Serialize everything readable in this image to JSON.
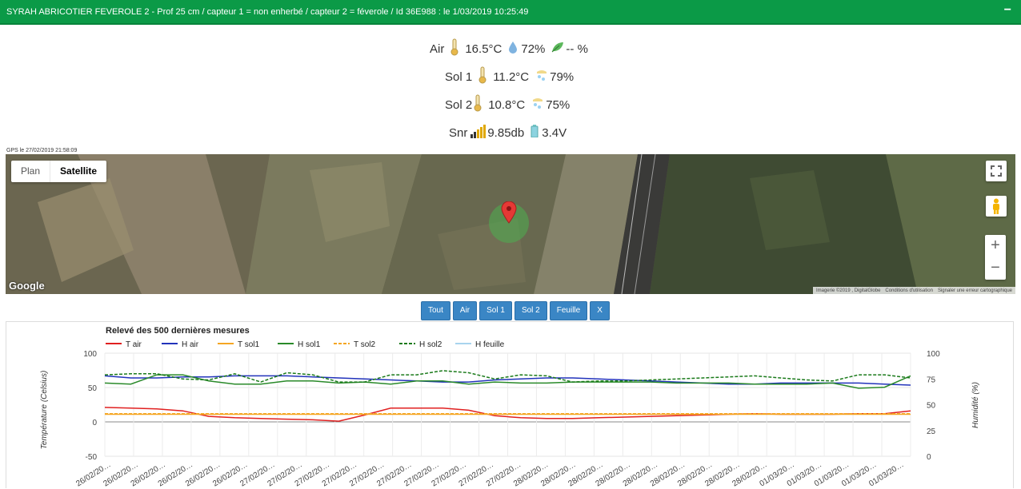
{
  "header": {
    "title": "SYRAH ABRICOTIER FEVEROLE 2 - Prof 25 cm / capteur 1 = non enherbé / capteur 2 = féverole / Id 36E988 : le 1/03/2019 10:25:49",
    "collapse": "−"
  },
  "readings": {
    "air": {
      "label": "Air",
      "temp": "16.5°C",
      "humidity": "72%",
      "leaf": "-- %"
    },
    "sol1": {
      "label": "Sol 1",
      "temp": "11.2°C",
      "humidity": "79%"
    },
    "sol2": {
      "label": "Sol 2",
      "temp": "10.8°C",
      "humidity": "75%"
    },
    "snr": {
      "label": "Snr",
      "signal": "9.85db",
      "battery": "3.4V"
    }
  },
  "gps": {
    "label": "GPS le 27/02/2019 21:58:09"
  },
  "map": {
    "type_plan": "Plan",
    "type_satellite": "Satellite",
    "google": "Google",
    "zoom_in": "+",
    "zoom_out": "−",
    "footer": [
      "Imagerie ©2019 , DigitalGlobe",
      "Conditions d'utilisation",
      "Signaler une erreur cartographique"
    ]
  },
  "filters": [
    "Tout",
    "Air",
    "Sol 1",
    "Sol 2",
    "Feuille",
    "X"
  ],
  "colors": {
    "header": "#0b9a47",
    "button": "#3a86c5",
    "t_air": "#e02020",
    "h_air": "#2233bb",
    "t_sol1": "#f5a623",
    "h_sol1": "#2a8a2a",
    "t_sol2": "#f5a623",
    "h_sol2": "#1a7a1a",
    "h_feuille": "#a8d4ee"
  },
  "chart_data": {
    "type": "line",
    "title": "Relevé des 500 dernières mesures",
    "ylabel": "Température (Celsius)",
    "y2label": "Humidité (%)",
    "ylim": [
      -50,
      100
    ],
    "y2lim": [
      0,
      100
    ],
    "yticks": [
      "100",
      "50",
      "0",
      "-50"
    ],
    "y2ticks": [
      "100",
      "75",
      "50",
      "25",
      "0"
    ],
    "x_tick_label": "26/02/20…",
    "x": [
      "26/02/20…",
      "26/02/20…",
      "26/02/20…",
      "26/02/20…",
      "26/02/20…",
      "26/02/20…",
      "27/02/20…",
      "27/02/20…",
      "27/02/20…",
      "27/02/20…",
      "27/02/20…",
      "27/02/20…",
      "27/02/20…",
      "27/02/20…",
      "27/02/20…",
      "27/02/20…",
      "28/02/20…",
      "28/02/20…",
      "28/02/20…",
      "28/02/20…",
      "28/02/20…",
      "28/02/20…",
      "28/02/20…",
      "28/02/20…",
      "28/02/20…",
      "01/03/20…",
      "01/03/20…",
      "01/03/20…",
      "01/03/20…",
      "01/03/20…"
    ],
    "series": [
      {
        "name": "T air",
        "axis": "left",
        "dash": false,
        "values": [
          21,
          20,
          19,
          16,
          8,
          6,
          5,
          4,
          3,
          1,
          10,
          20,
          20,
          20,
          17,
          9,
          6,
          5,
          5,
          6,
          7,
          8,
          9,
          10,
          11,
          12,
          11,
          11,
          11,
          12,
          12,
          16
        ]
      },
      {
        "name": "H air",
        "axis": "right",
        "dash": false,
        "values": [
          78,
          76,
          76,
          77,
          77,
          78,
          78,
          78,
          77,
          76,
          75,
          74,
          73,
          72,
          72,
          74,
          75,
          76,
          76,
          75,
          74,
          73,
          72,
          71,
          70,
          70,
          71,
          71,
          71,
          71,
          70,
          69
        ]
      },
      {
        "name": "T sol1",
        "axis": "left",
        "dash": false,
        "values": [
          11,
          11,
          11,
          11,
          11,
          11,
          11,
          11,
          11,
          11,
          11,
          11,
          11,
          11,
          11,
          11,
          11,
          11,
          11,
          11,
          11,
          11,
          11,
          11,
          11,
          11,
          11,
          11,
          11,
          11,
          11,
          11
        ]
      },
      {
        "name": "H sol1",
        "axis": "right",
        "dash": false,
        "values": [
          71,
          70,
          79,
          79,
          73,
          70,
          70,
          73,
          73,
          71,
          72,
          70,
          73,
          73,
          70,
          72,
          71,
          71,
          72,
          72,
          72,
          72,
          71,
          71,
          71,
          70,
          70,
          70,
          71,
          66,
          67,
          78
        ]
      },
      {
        "name": "T sol2",
        "axis": "left",
        "dash": true,
        "values": [
          12,
          12,
          12,
          12,
          12,
          12,
          12,
          12,
          12,
          12,
          12,
          12,
          12,
          12,
          12,
          12,
          12,
          12,
          12,
          12,
          12,
          12,
          12,
          12,
          12,
          12,
          12,
          12,
          12,
          12,
          12,
          12
        ]
      },
      {
        "name": "H sol2",
        "axis": "right",
        "dash": true,
        "values": [
          79,
          80,
          80,
          75,
          74,
          80,
          72,
          81,
          79,
          72,
          72,
          79,
          79,
          83,
          81,
          75,
          79,
          78,
          72,
          73,
          73,
          74,
          75,
          76,
          77,
          78,
          76,
          74,
          73,
          79,
          79,
          76
        ]
      },
      {
        "name": "H feuille",
        "axis": "right",
        "dash": false,
        "values": []
      }
    ]
  }
}
